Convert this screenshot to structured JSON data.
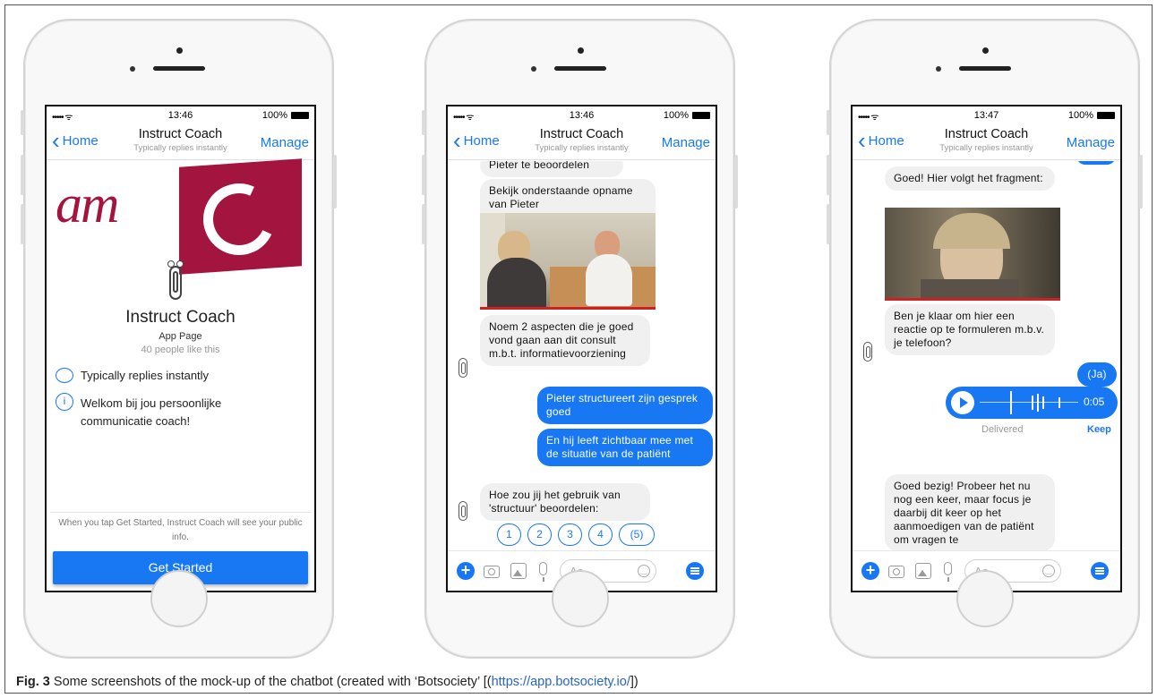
{
  "caption": {
    "label": "Fig. 3",
    "text": " Some screenshots of the mock-up of the chatbot (created with ‘Botsociety’ [(",
    "link": "https://app.botsociety.io/",
    "tail": "])"
  },
  "phones": [
    {
      "status": {
        "signal": "••••• ᯤ",
        "time": "13:46",
        "battery": "100%"
      },
      "nav": {
        "back": "Home",
        "title": "Instruct Coach",
        "subtitle": "Typically replies instantly",
        "manage": "Manage"
      },
      "logo_text": "am",
      "profile": {
        "name": "Instruct Coach",
        "category": "App Page",
        "likes": "40 people like this"
      },
      "info": [
        {
          "icon": "chat-bubble-icon",
          "text": "Typically replies instantly"
        },
        {
          "icon": "info-icon",
          "text": "Welkom bij jou persoonlijke communicatie coach!"
        }
      ],
      "notice": "When you tap Get Started, Instruct Coach will see your public info.",
      "get_started": "Get Started"
    },
    {
      "status": {
        "signal": "••••• ᯤ",
        "time": "13:46",
        "battery": "100%"
      },
      "nav": {
        "back": "Home",
        "title": "Instruct Coach",
        "subtitle": "Typically replies instantly",
        "manage": "Manage"
      },
      "messages": [
        "Pieter te beoordelen",
        "Bekijk onderstaande opname van Pieter",
        "Noem 2 aspecten die je goed vond gaan aan dit consult m.b.t. informatievoorziening",
        "Pieter structureert zijn gesprek goed",
        "En hij leeft zichtbaar mee met de situatie van de patiënt",
        "Hoe zou jij het gebruik van 'structuur' beoordelen:"
      ],
      "quick_replies": [
        "1",
        "2",
        "3",
        "4",
        "(5)"
      ],
      "input_placeholder": "Aa"
    },
    {
      "status": {
        "signal": "••••• ᯤ",
        "time": "13:47",
        "battery": "100%"
      },
      "nav": {
        "back": "Home",
        "title": "Instruct Coach",
        "subtitle": "Typically replies instantly",
        "manage": "Manage"
      },
      "messages": [
        "Goed! Hier volgt het fragment:",
        "Ben je klaar om hier een reactie op te formuleren m.b.v. je telefoon?",
        "(Ja)",
        "Goed bezig! Probeer het nu nog een keer, maar focus je daarbij dit keer op het aanmoedigen van de patiënt om vragen te"
      ],
      "audio": {
        "duration": "0:05",
        "delivered": "Delivered",
        "keep": "Keep"
      },
      "input_placeholder": "Aa"
    }
  ],
  "colors": {
    "accent": "#1878f3",
    "amc_red": "#a3153f"
  }
}
